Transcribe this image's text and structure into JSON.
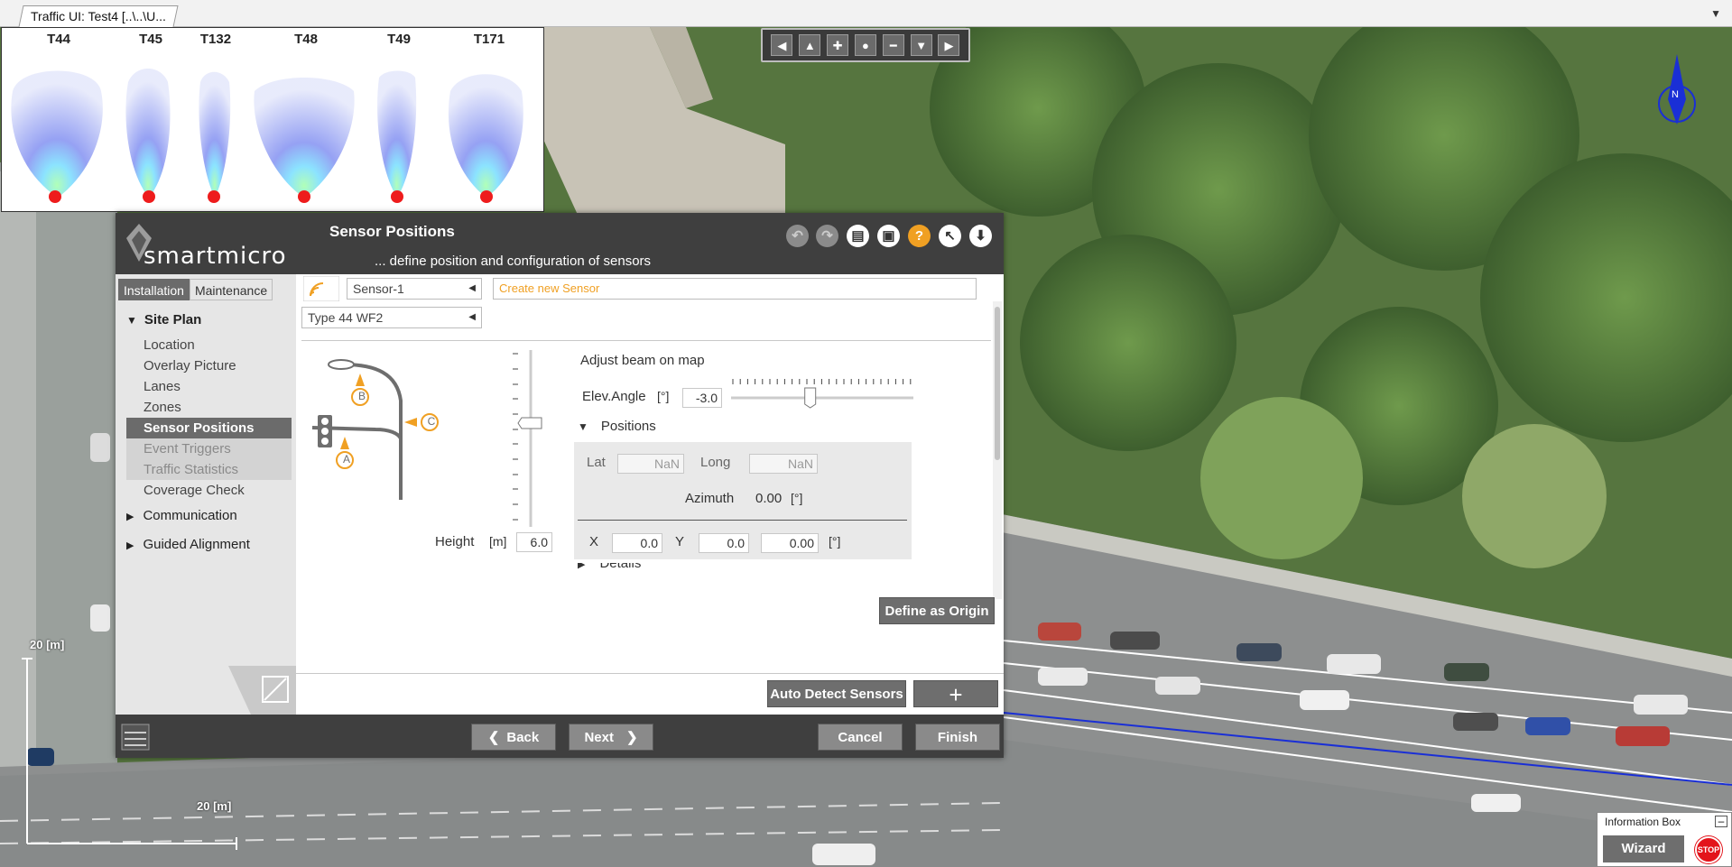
{
  "window": {
    "tab_title": "Traffic UI: Test4 [..\\..\\U..."
  },
  "beam_panel": {
    "labels": [
      "T44",
      "T45",
      "T132",
      "T48",
      "T49",
      "T171"
    ]
  },
  "map": {
    "scale_vertical": "20 [m]",
    "scale_horizontal": "20 [m]",
    "compass_letter": "N",
    "nav_buttons": [
      "pan-left",
      "pan-up",
      "zoom-in",
      "center",
      "zoom-out",
      "pan-down",
      "pan-right"
    ]
  },
  "dialog": {
    "logo": "smartmicro",
    "title": "Sensor Positions",
    "subtitle": "... define position and configuration of sensors",
    "header_icons": [
      "undo-icon",
      "redo-icon",
      "save-icon",
      "save-as-icon",
      "help-icon",
      "pointer-help-icon",
      "download-icon"
    ],
    "tabs": [
      "Installation",
      "Maintenance"
    ],
    "nav": {
      "site_plan": "Site Plan",
      "items": [
        {
          "label": "Location",
          "state": "normal"
        },
        {
          "label": "Overlay Picture",
          "state": "normal"
        },
        {
          "label": "Lanes",
          "state": "normal"
        },
        {
          "label": "Zones",
          "state": "normal"
        },
        {
          "label": "Sensor Positions",
          "state": "active"
        },
        {
          "label": "Event Triggers",
          "state": "grey"
        },
        {
          "label": "Traffic Statistics",
          "state": "grey"
        },
        {
          "label": "Coverage Check",
          "state": "normal"
        }
      ],
      "communication": "Communication",
      "guided_alignment": "Guided Alignment"
    },
    "sensor_select": "Sensor-1",
    "create_sensor_placeholder": "Create new Sensor",
    "type_select": "Type 44 WF2",
    "mount_labels": {
      "a": "A",
      "b": "B",
      "c": "C"
    },
    "height_label": "Height",
    "height_unit": "[m]",
    "height_value": "6.0",
    "adjust_beam": "Adjust beam on map",
    "elev_label": "Elev.Angle",
    "elev_unit": "[°]",
    "elev_value": "-3.0",
    "elev_slider_fraction": 0.43,
    "positions_label": "Positions",
    "lat_label": "Lat",
    "lat_value": "NaN",
    "long_label": "Long",
    "long_value": "NaN",
    "azimuth_label": "Azimuth",
    "azimuth_value": "0.00",
    "azimuth_unit": "[°]",
    "x_label": "X",
    "x_value": "0.0",
    "y_label": "Y",
    "y_value": "0.0",
    "rot_value": "0.00",
    "rot_unit": "[°]",
    "details_label": "Details",
    "define_origin": "Define as Origin",
    "auto_detect": "Auto Detect Sensors",
    "add": "+",
    "back": "Back",
    "next": "Next",
    "cancel": "Cancel",
    "finish": "Finish"
  },
  "info_box": {
    "title": "Information Box",
    "wizard": "Wizard",
    "stop": "STOP"
  }
}
